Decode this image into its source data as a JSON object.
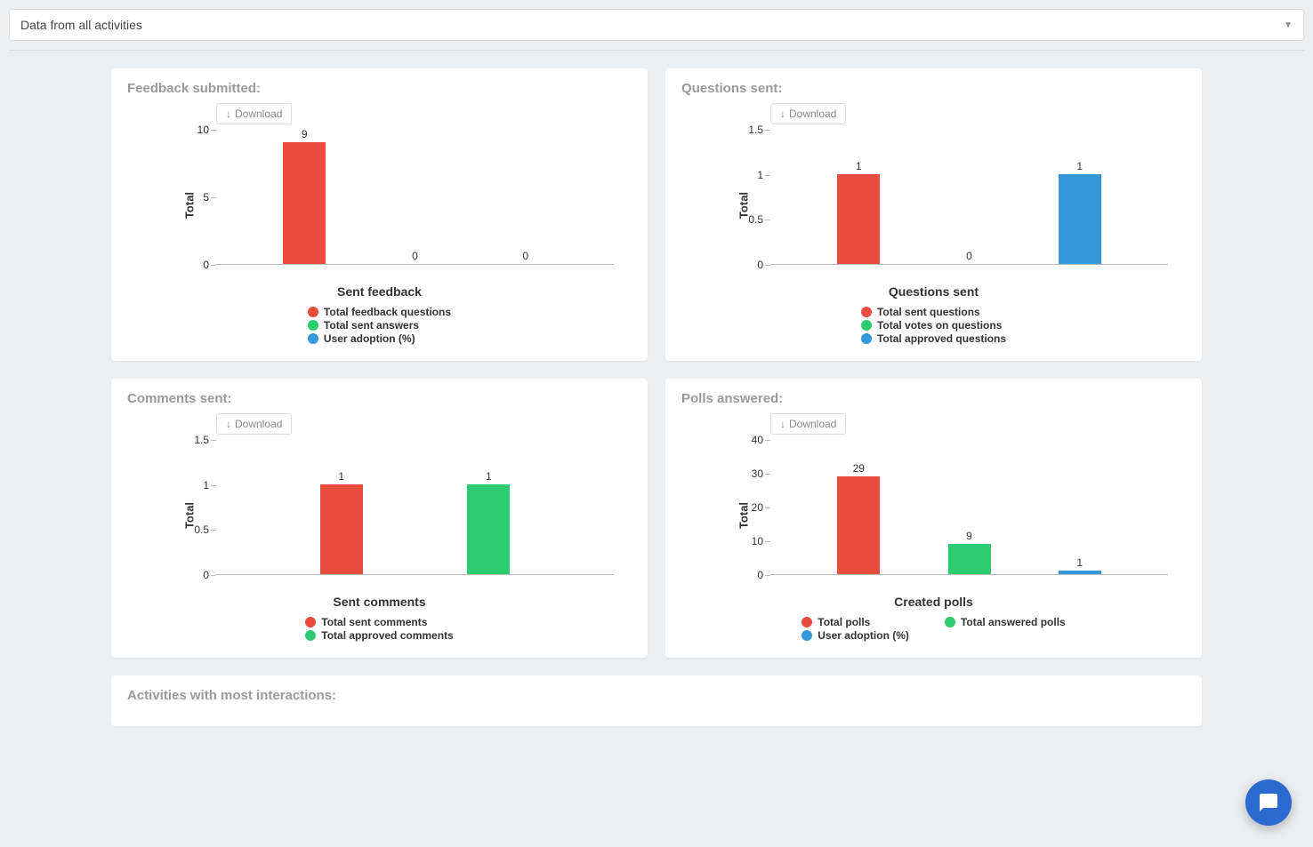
{
  "selector": {
    "value": "Data from all activities"
  },
  "download_label": "Download",
  "colors": {
    "red": "#e74c3c",
    "green": "#2ecc71",
    "blue": "#3498db"
  },
  "cards": {
    "feedback": {
      "title": "Feedback submitted:",
      "xlabel": "Sent feedback",
      "ylabel": "Total",
      "ymax": 10,
      "ticks": [
        0,
        5,
        10
      ],
      "series": [
        {
          "name": "Total feedback questions",
          "value": 9,
          "color": "red"
        },
        {
          "name": "Total sent answers",
          "value": 0,
          "color": "green"
        },
        {
          "name": "User adoption (%)",
          "value": 0,
          "color": "blue"
        }
      ],
      "legend_layout": [
        [
          "Total feedback questions",
          "Total sent answers",
          "User adoption (%)"
        ]
      ]
    },
    "questions": {
      "title": "Questions sent:",
      "xlabel": "Questions sent",
      "ylabel": "Total",
      "ymax": 1.5,
      "ticks": [
        0,
        0.5,
        1,
        1.5
      ],
      "series": [
        {
          "name": "Total sent questions",
          "value": 1,
          "color": "red"
        },
        {
          "name": "Total votes on questions",
          "value": 0,
          "color": "green"
        },
        {
          "name": "Total approved questions",
          "value": 1,
          "color": "blue"
        }
      ],
      "legend_layout": [
        [
          "Total sent questions",
          "Total votes on questions",
          "Total approved questions"
        ]
      ]
    },
    "comments": {
      "title": "Comments sent:",
      "xlabel": "Sent comments",
      "ylabel": "Total",
      "ymax": 1.5,
      "ticks": [
        0,
        0.5,
        1,
        1.5
      ],
      "series": [
        {
          "name": "Total sent comments",
          "value": 1,
          "color": "red"
        },
        {
          "name": "Total approved comments",
          "value": 1,
          "color": "green"
        }
      ],
      "legend_layout": [
        [
          "Total sent comments",
          "Total approved comments"
        ]
      ]
    },
    "polls": {
      "title": "Polls answered:",
      "xlabel": "Created polls",
      "ylabel": "Total",
      "ymax": 40,
      "ticks": [
        0,
        10,
        20,
        30,
        40
      ],
      "series": [
        {
          "name": "Total polls",
          "value": 29,
          "color": "red"
        },
        {
          "name": "Total answered polls",
          "value": 9,
          "color": "green"
        },
        {
          "name": "User adoption (%)",
          "value": 1,
          "color": "blue"
        }
      ],
      "legend_layout": [
        [
          "Total polls",
          "User adoption (%)"
        ],
        [
          "Total answered polls"
        ]
      ]
    }
  },
  "bottom_card": {
    "title": "Activities with most interactions:"
  },
  "chart_data": [
    {
      "type": "bar",
      "title": "Sent feedback",
      "ylabel": "Total",
      "ylim": [
        0,
        10
      ],
      "categories": [
        "Total feedback questions",
        "Total sent answers",
        "User adoption (%)"
      ],
      "values": [
        9,
        0,
        0
      ]
    },
    {
      "type": "bar",
      "title": "Questions sent",
      "ylabel": "Total",
      "ylim": [
        0,
        1.5
      ],
      "categories": [
        "Total sent questions",
        "Total votes on questions",
        "Total approved questions"
      ],
      "values": [
        1,
        0,
        1
      ]
    },
    {
      "type": "bar",
      "title": "Sent comments",
      "ylabel": "Total",
      "ylim": [
        0,
        1.5
      ],
      "categories": [
        "Total sent comments",
        "Total approved comments"
      ],
      "values": [
        1,
        1
      ]
    },
    {
      "type": "bar",
      "title": "Created polls",
      "ylabel": "Total",
      "ylim": [
        0,
        40
      ],
      "categories": [
        "Total polls",
        "Total answered polls",
        "User adoption (%)"
      ],
      "values": [
        29,
        9,
        1
      ]
    }
  ]
}
